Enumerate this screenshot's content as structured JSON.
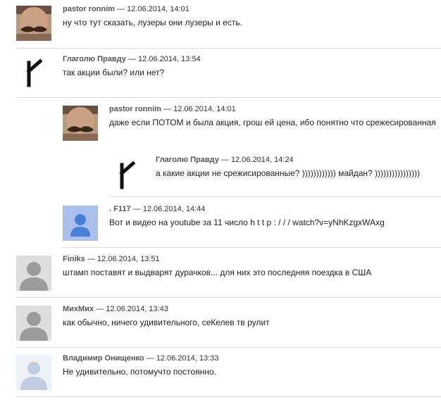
{
  "comments": [
    {
      "author": "pastor ronnim",
      "separator": "—",
      "date": "12.06.2014, 14:01",
      "text": "ну что тут сказать, лузеры они лузеры и есть.",
      "avatar": "mustache-avatar"
    },
    {
      "author": "Глаголю Правду",
      "separator": "—",
      "date": "12.06.2014, 13:54",
      "text": "так акции были? или нет?",
      "avatar": "rune-avatar"
    },
    {
      "author": "pastor ronnim",
      "separator": "—",
      "date": "12.06.2014, 14:01",
      "text": "даже если ПОТОМ и была акция, грош ей цена, ибо понятно что срежесированная",
      "avatar": "mustache-avatar"
    },
    {
      "author": "Глаголю Правду",
      "separator": "—",
      "date": "12.06.2014, 14:24",
      "text": "а какие акции не срежисированные? )))))))))))) майдан? ))))))))))))))))",
      "avatar": "rune-avatar"
    },
    {
      "author": ". F117",
      "separator": "—",
      "date": "12.06.2014, 14:44",
      "text": "Вот и видео на youtube за 11 число h t t p : / / / watch?v=yNhKzgxWAxg",
      "avatar": "default-blue-avatar"
    },
    {
      "author": "Finiks",
      "separator": "—",
      "date": "12.06.2014, 13:51",
      "text": "штамп поставят и выдварят дурачков... для них это последняя поездка в США",
      "avatar": "default-gray-avatar"
    },
    {
      "author": "МихМих",
      "separator": "—",
      "date": "12.06.2014, 13:43",
      "text": "как обычно, ничего удивительного, сеКелев тв рулит",
      "avatar": "default-gray-avatar"
    },
    {
      "author": "Владимир Онищенко",
      "separator": "—",
      "date": "12.06.2014, 13:33",
      "text": "Не удивительно, потомучто постоянно.",
      "avatar": "default-profile-avatar"
    }
  ]
}
